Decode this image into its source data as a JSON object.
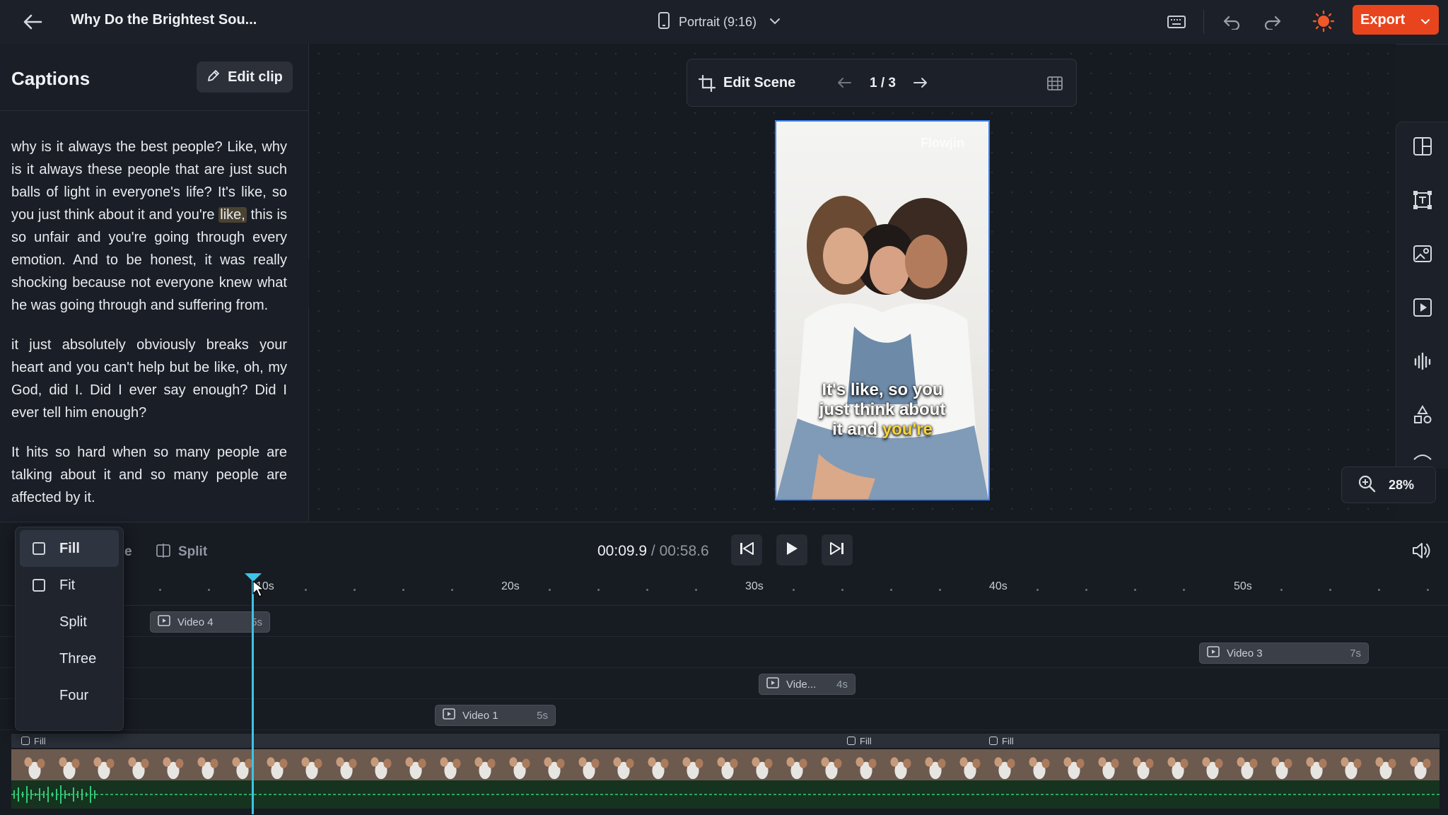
{
  "header": {
    "title": "Why Do the Brightest Sou...",
    "format": "Portrait (9:16)",
    "export_label": "Export"
  },
  "captions": {
    "title": "Captions",
    "edit_clip_label": "Edit clip",
    "p1_a": "why is it always the best people? Like, why is it always these people that are just such balls of light in everyone's life? It's like, so you just think about it and you're",
    "p1_hl": "like,",
    "p1_b": " this is so unfair and you're going through every emotion. And to be honest, it was really shocking because not everyone knew what he was going through and suffering from.",
    "p2": "it just absolutely obviously breaks your heart and you can't help but be like, oh, my God, did I. Did I ever say enough? Did I ever tell him enough?",
    "p3": "It hits so hard when so many people are talking about it and so many people are affected by it."
  },
  "scene": {
    "edit_scene_label": "Edit Scene",
    "counter": "1 / 3",
    "watermark": "Flowjin",
    "caption_line1": "It's like, so you",
    "caption_line2": "just think about",
    "caption_line3a": "it and ",
    "caption_line3b": "you're"
  },
  "zoom": {
    "level": "28%"
  },
  "player": {
    "current_time": "00:09.9",
    "separator": " / ",
    "total_time": "00:58.6",
    "split_label": "Split"
  },
  "layout_menu": {
    "items": [
      "Fill",
      "Fit",
      "Split",
      "Three",
      "Four"
    ]
  },
  "timeline": {
    "ticks": [
      "10s",
      "20s",
      "30s",
      "40s",
      "50s"
    ],
    "clips": [
      {
        "label": "Video 4",
        "duration": "5s"
      },
      {
        "label": "Video 3",
        "duration": "7s"
      },
      {
        "label": "Vide...",
        "duration": "4s"
      },
      {
        "label": "Video 1",
        "duration": "5s"
      }
    ],
    "segment_labels": [
      "Fill",
      "Fill",
      "Fill"
    ]
  },
  "colors": {
    "accent_export": "#e8451e",
    "playhead": "#3fc3e6",
    "caption_highlight": "#f5d43b",
    "waveform": "#2fb56c"
  }
}
